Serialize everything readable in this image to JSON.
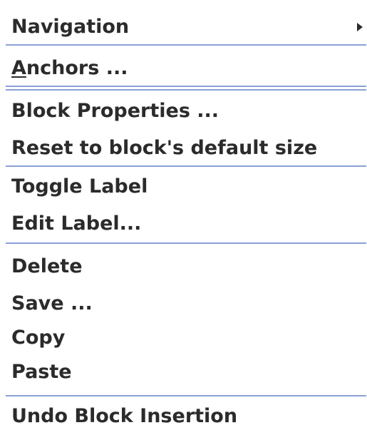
{
  "menu": {
    "navigation": {
      "label": "Navigation",
      "submenu_icon": "triangle-right-icon"
    },
    "anchors": {
      "mnemonic": "A",
      "rest": "nchors ..."
    },
    "block_properties": {
      "label": "Block Properties ..."
    },
    "reset_size": {
      "label": "Reset to block's default size"
    },
    "toggle_label": {
      "label": "Toggle Label"
    },
    "edit_label": {
      "label": "Edit Label..."
    },
    "delete": {
      "label": "Delete"
    },
    "save": {
      "label": "Save ..."
    },
    "copy": {
      "label": "Copy"
    },
    "paste": {
      "label": "Paste"
    },
    "undo": {
      "label": "Undo Block Insertion"
    }
  },
  "colors": {
    "background": "#ffffff",
    "text": "#2b2b2b",
    "separator": "#8aa0d6"
  }
}
